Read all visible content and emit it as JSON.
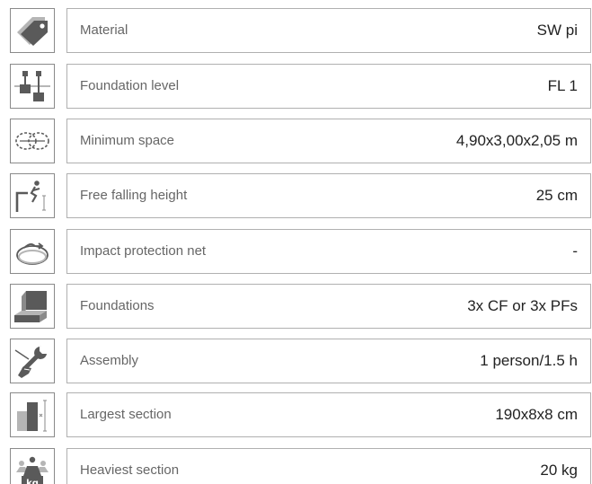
{
  "specs": [
    {
      "icon": "price-tag-icon",
      "label": "Material",
      "value": "SW pi"
    },
    {
      "icon": "foundation-level-icon",
      "label": "Foundation level",
      "value": "FL 1"
    },
    {
      "icon": "minimum-space-icon",
      "label": "Minimum space",
      "value": "4,90x3,00x2,05 m"
    },
    {
      "icon": "free-fall-icon",
      "label": "Free falling height",
      "value": "25 cm"
    },
    {
      "icon": "protection-net-icon",
      "label": "Impact protection net",
      "value": "-"
    },
    {
      "icon": "foundation-block-icon",
      "label": "Foundations",
      "value": "3x CF or 3x PFs"
    },
    {
      "icon": "wrench-hand-icon",
      "label": "Assembly",
      "value": "1 person/1.5 h"
    },
    {
      "icon": "section-dimensions-icon",
      "label": "Largest section",
      "value": "190x8x8 cm"
    },
    {
      "icon": "weight-kg-icon",
      "label": "Heaviest section",
      "value": "20 kg",
      "icon_text": "kg"
    }
  ],
  "colors": {
    "icon_fill": "#5a5a5a",
    "icon_light": "#b5b5b5",
    "border": "#b0b0b0",
    "label_text": "#666666",
    "value_text": "#222222"
  }
}
